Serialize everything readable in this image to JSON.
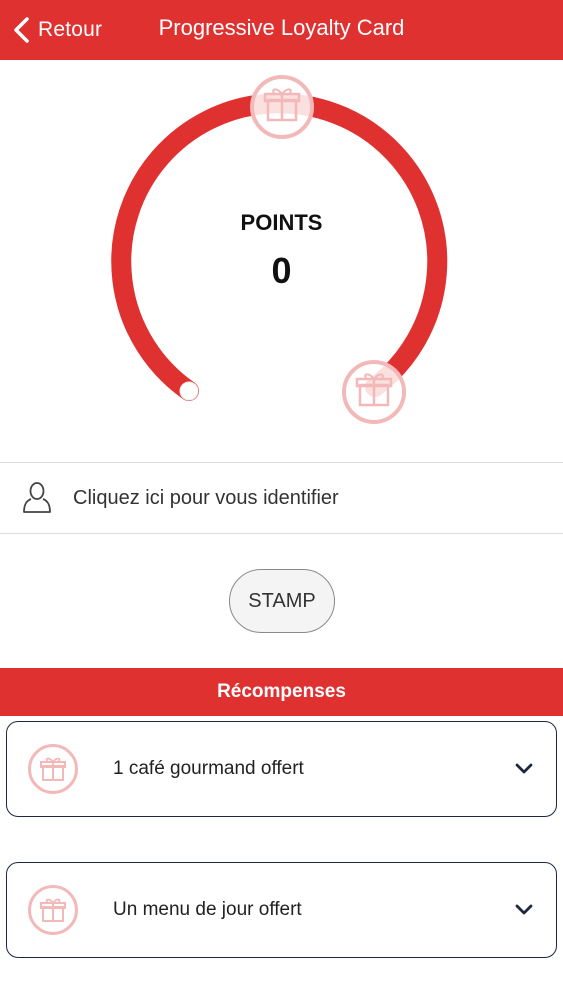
{
  "nav": {
    "back_label": "Retour",
    "title": "Progressive Loyalty Card"
  },
  "gauge": {
    "label": "POINTS",
    "value": "0",
    "progress": 0,
    "accent_color": "#e03131",
    "marker_color": "#f3b9b9",
    "icons": [
      "gift-icon",
      "gift-icon"
    ]
  },
  "identify": {
    "text": "Cliquez ici pour vous identifier",
    "icon": "person-icon"
  },
  "stamp": {
    "label": "STAMP"
  },
  "rewards": {
    "header": "Récompenses",
    "items": [
      {
        "label": "1 café gourmand offert",
        "icon": "gift-icon"
      },
      {
        "label": "Un menu de jour offert",
        "icon": "gift-icon"
      }
    ]
  }
}
